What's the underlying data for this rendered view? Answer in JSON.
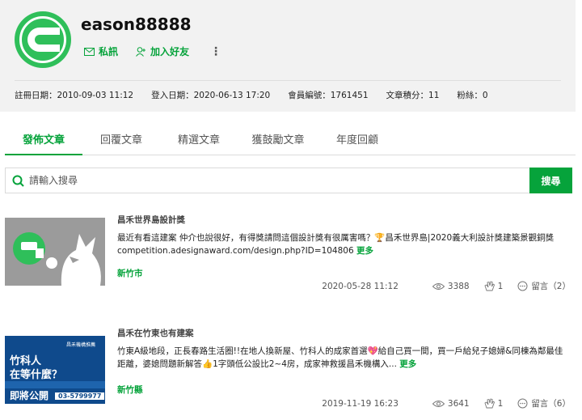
{
  "profile": {
    "username": "eason88888",
    "actions": {
      "message": "私訊",
      "add_friend": "加入好友",
      "more": "⋮"
    },
    "stats": {
      "register": "註冊日期：2010-09-03 11:12",
      "login": "登入日期：2020-06-13 17:20",
      "member_id": "會員編號：1761451",
      "points": "文章積分：11",
      "fans": "粉絲：0"
    }
  },
  "tabs": [
    "發佈文章",
    "回覆文章",
    "精選文章",
    "獲鼓勵文章",
    "年度回顧"
  ],
  "search": {
    "placeholder": "請輸入搜尋",
    "button": "搜尋"
  },
  "posts": [
    {
      "category": "昌禾世界島設計獎",
      "body": "最近有看這建案 仲介也說很好，有得獎請問這個設計獎有很厲害嗎？🏆昌禾世界島|2020義大利設計獎建築景觀銅獎 competition.adesignaward.com/design.php?ID=104806",
      "more": "更多",
      "location": "新竹市",
      "date": "2020-05-28 11:12",
      "views": "3388",
      "likes": "1",
      "comments": "留言（2）"
    },
    {
      "category": "昌禾在竹東也有建案",
      "body": "竹東A級地段，正長春路生活圈!!在地人換新屋、竹科人的成家首選💖給自己買一間，買一戶給兒子媳婦&同棟為鄰最佳距離，婆媳問題新解答👍1字頭低公設比2~4房，成家神救援昌禾機構入...",
      "more": "更多",
      "location": "新竹縣",
      "date": "2019-11-19 16:23",
      "views": "3641",
      "likes": "1",
      "comments": "留言（6）",
      "thumb": {
        "line1": "竹科人",
        "line2": "在等什麼？",
        "big": "即將公開",
        "phone": "03-5799977",
        "logo": "昌禾機構推薦"
      }
    }
  ],
  "colors": {
    "accent": "#06a33b",
    "avatar": "#2fbf5a",
    "profile_bg": "#f2f2f2"
  }
}
